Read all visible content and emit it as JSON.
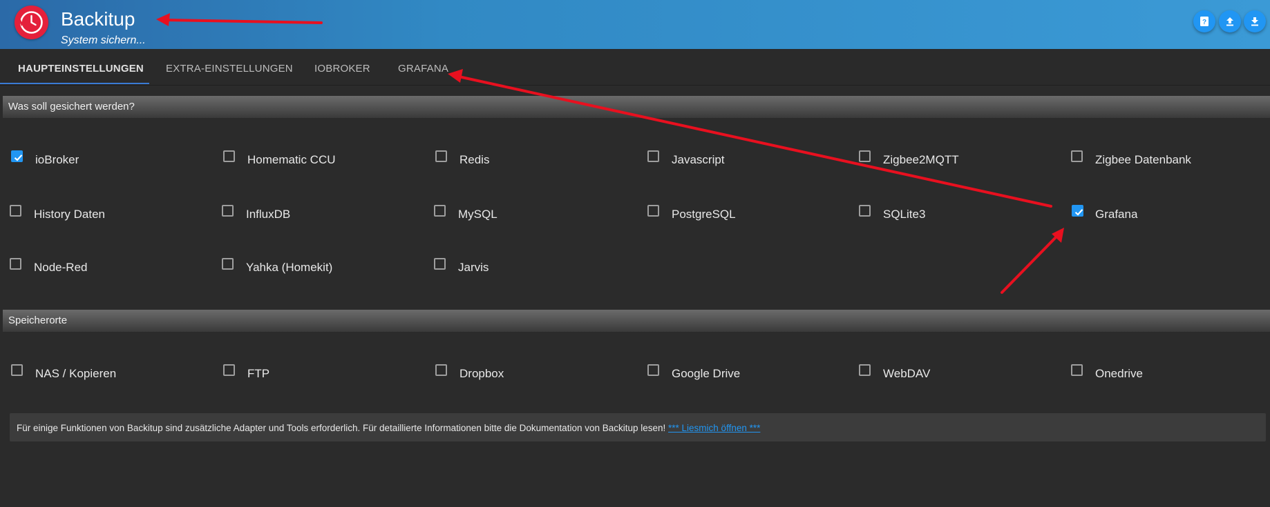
{
  "header": {
    "title": "Backitup",
    "subtitle": "System sichern...",
    "buttons": [
      {
        "icon": "help-icon"
      },
      {
        "icon": "upload-icon"
      },
      {
        "icon": "download-icon"
      }
    ]
  },
  "tabs": [
    {
      "label": "Haupteinstellungen",
      "active": true
    },
    {
      "label": "Extra-Einstellungen",
      "active": false
    },
    {
      "label": "ioBroker",
      "active": false
    },
    {
      "label": "Grafana",
      "active": false
    }
  ],
  "sections": {
    "backup_what": {
      "title": "Was soll gesichert werden?",
      "rows": [
        [
          {
            "label": "ioBroker",
            "checked": true
          },
          {
            "label": "Homematic CCU",
            "checked": false
          },
          {
            "label": "Redis",
            "checked": false
          },
          {
            "label": "Javascript",
            "checked": false
          },
          {
            "label": "Zigbee2MQTT",
            "checked": false
          },
          {
            "label": "Zigbee Datenbank",
            "checked": false
          }
        ],
        [
          {
            "label": "History Daten",
            "checked": false
          },
          {
            "label": "InfluxDB",
            "checked": false
          },
          {
            "label": "MySQL",
            "checked": false
          },
          {
            "label": "PostgreSQL",
            "checked": false
          },
          {
            "label": "SQLite3",
            "checked": false
          },
          {
            "label": "Grafana",
            "checked": true
          }
        ],
        [
          {
            "label": "Node-Red",
            "checked": false
          },
          {
            "label": "Yahka (Homekit)",
            "checked": false
          },
          {
            "label": "Jarvis",
            "checked": false
          }
        ]
      ]
    },
    "storage": {
      "title": "Speicherorte",
      "items": [
        {
          "label": "NAS / Kopieren",
          "checked": false
        },
        {
          "label": "FTP",
          "checked": false
        },
        {
          "label": "Dropbox",
          "checked": false
        },
        {
          "label": "Google Drive",
          "checked": false
        },
        {
          "label": "WebDAV",
          "checked": false
        },
        {
          "label": "Onedrive",
          "checked": false
        }
      ]
    }
  },
  "info": {
    "text": "Für einige Funktionen von Backitup sind zusätzliche Adapter und Tools erforderlich. Für detaillierte Informationen bitte die Dokumentation von Backitup lesen! ",
    "link": "*** Liesmich öffnen ***"
  },
  "colors": {
    "header_start": "#2b6aa8",
    "header_end": "#3b9ad6",
    "accent": "#2196f3",
    "logo": "#e4203b",
    "annotation_arrow": "#e8101f"
  }
}
